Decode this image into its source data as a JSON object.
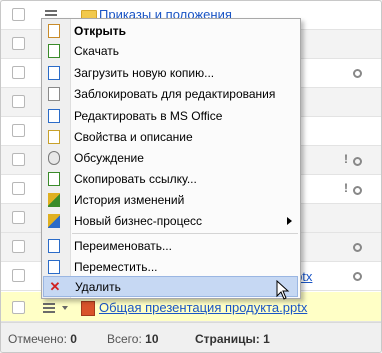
{
  "rows": [
    {
      "label": "Приказы и положения",
      "type": "folder"
    },
    {
      "label": ""
    },
    {
      "label": ""
    },
    {
      "label": ""
    },
    {
      "label": ""
    },
    {
      "label": ""
    },
    {
      "label": ""
    },
    {
      "label": ""
    },
    {
      "label": "a.pptx"
    },
    {
      "label": "Общая презентация продукта.pptx"
    }
  ],
  "context_menu": {
    "items": [
      {
        "label": "Открыть",
        "icon": "document-icon"
      },
      {
        "label": "Скачать",
        "icon": "download-icon"
      },
      {
        "label": "Загрузить новую копию...",
        "icon": "upload-icon"
      },
      {
        "label": "Заблокировать для редактирования",
        "icon": "lock-icon"
      },
      {
        "label": "Редактировать в MS Office",
        "icon": "edit-icon"
      },
      {
        "label": "Свойства и описание",
        "icon": "properties-icon"
      },
      {
        "label": "Обсуждение",
        "icon": "chat-icon"
      },
      {
        "label": "Скопировать ссылку...",
        "icon": "copy-link-icon"
      },
      {
        "label": "История изменений",
        "icon": "history-icon"
      },
      {
        "label": "Новый бизнес-процесс",
        "icon": "workflow-icon"
      },
      {
        "label": "Переименовать...",
        "icon": "rename-icon"
      },
      {
        "label": "Переместить...",
        "icon": "move-icon"
      },
      {
        "label": "Удалить",
        "icon": "delete-icon"
      }
    ]
  },
  "footer": {
    "selected_label": "Отмечено:",
    "selected_value": "0",
    "total_label": "Всего:",
    "total_value": "10",
    "pages_label": "Страницы:",
    "pages_value": "1"
  },
  "colors": {
    "link": "#1a55c5",
    "highlight_row": "#ffffc6",
    "menu_active": "#c6d8f3"
  }
}
